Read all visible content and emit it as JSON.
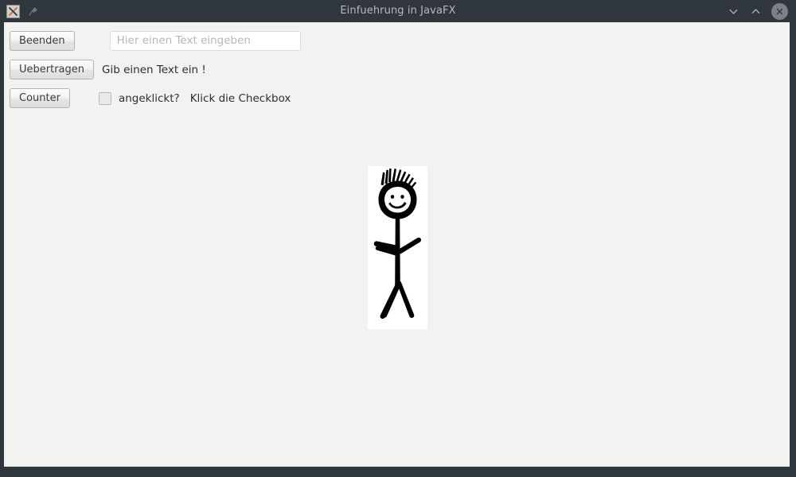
{
  "window": {
    "title": "Einfuehrung in JavaFX",
    "app_icon": "x-window-icon",
    "pin_icon": "pin-icon",
    "controls": {
      "minimize": "chevron-down-icon",
      "maximize": "chevron-up-icon",
      "close": "close-icon"
    },
    "colors": {
      "titlebar": "#2f363c",
      "title_text": "#b3b9bd",
      "client_background": "#f2f2f1",
      "close_button": "#7c8187"
    }
  },
  "form": {
    "row1": {
      "button_label": "Beenden",
      "input_value": "",
      "input_placeholder": "Hier einen Text eingeben"
    },
    "row2": {
      "button_label": "Uebertragen",
      "label": "Gib einen Text ein !"
    },
    "row3": {
      "button_label": "Counter",
      "checkbox_checked": false,
      "checkbox_label": "angeklickt?",
      "hint_label": "Klick die Checkbox"
    }
  },
  "picture": {
    "name": "stick-figure-image",
    "description": "Hand drawn smiling stick figure with spiky hair",
    "background": "#ffffff",
    "ink": "#000000"
  }
}
